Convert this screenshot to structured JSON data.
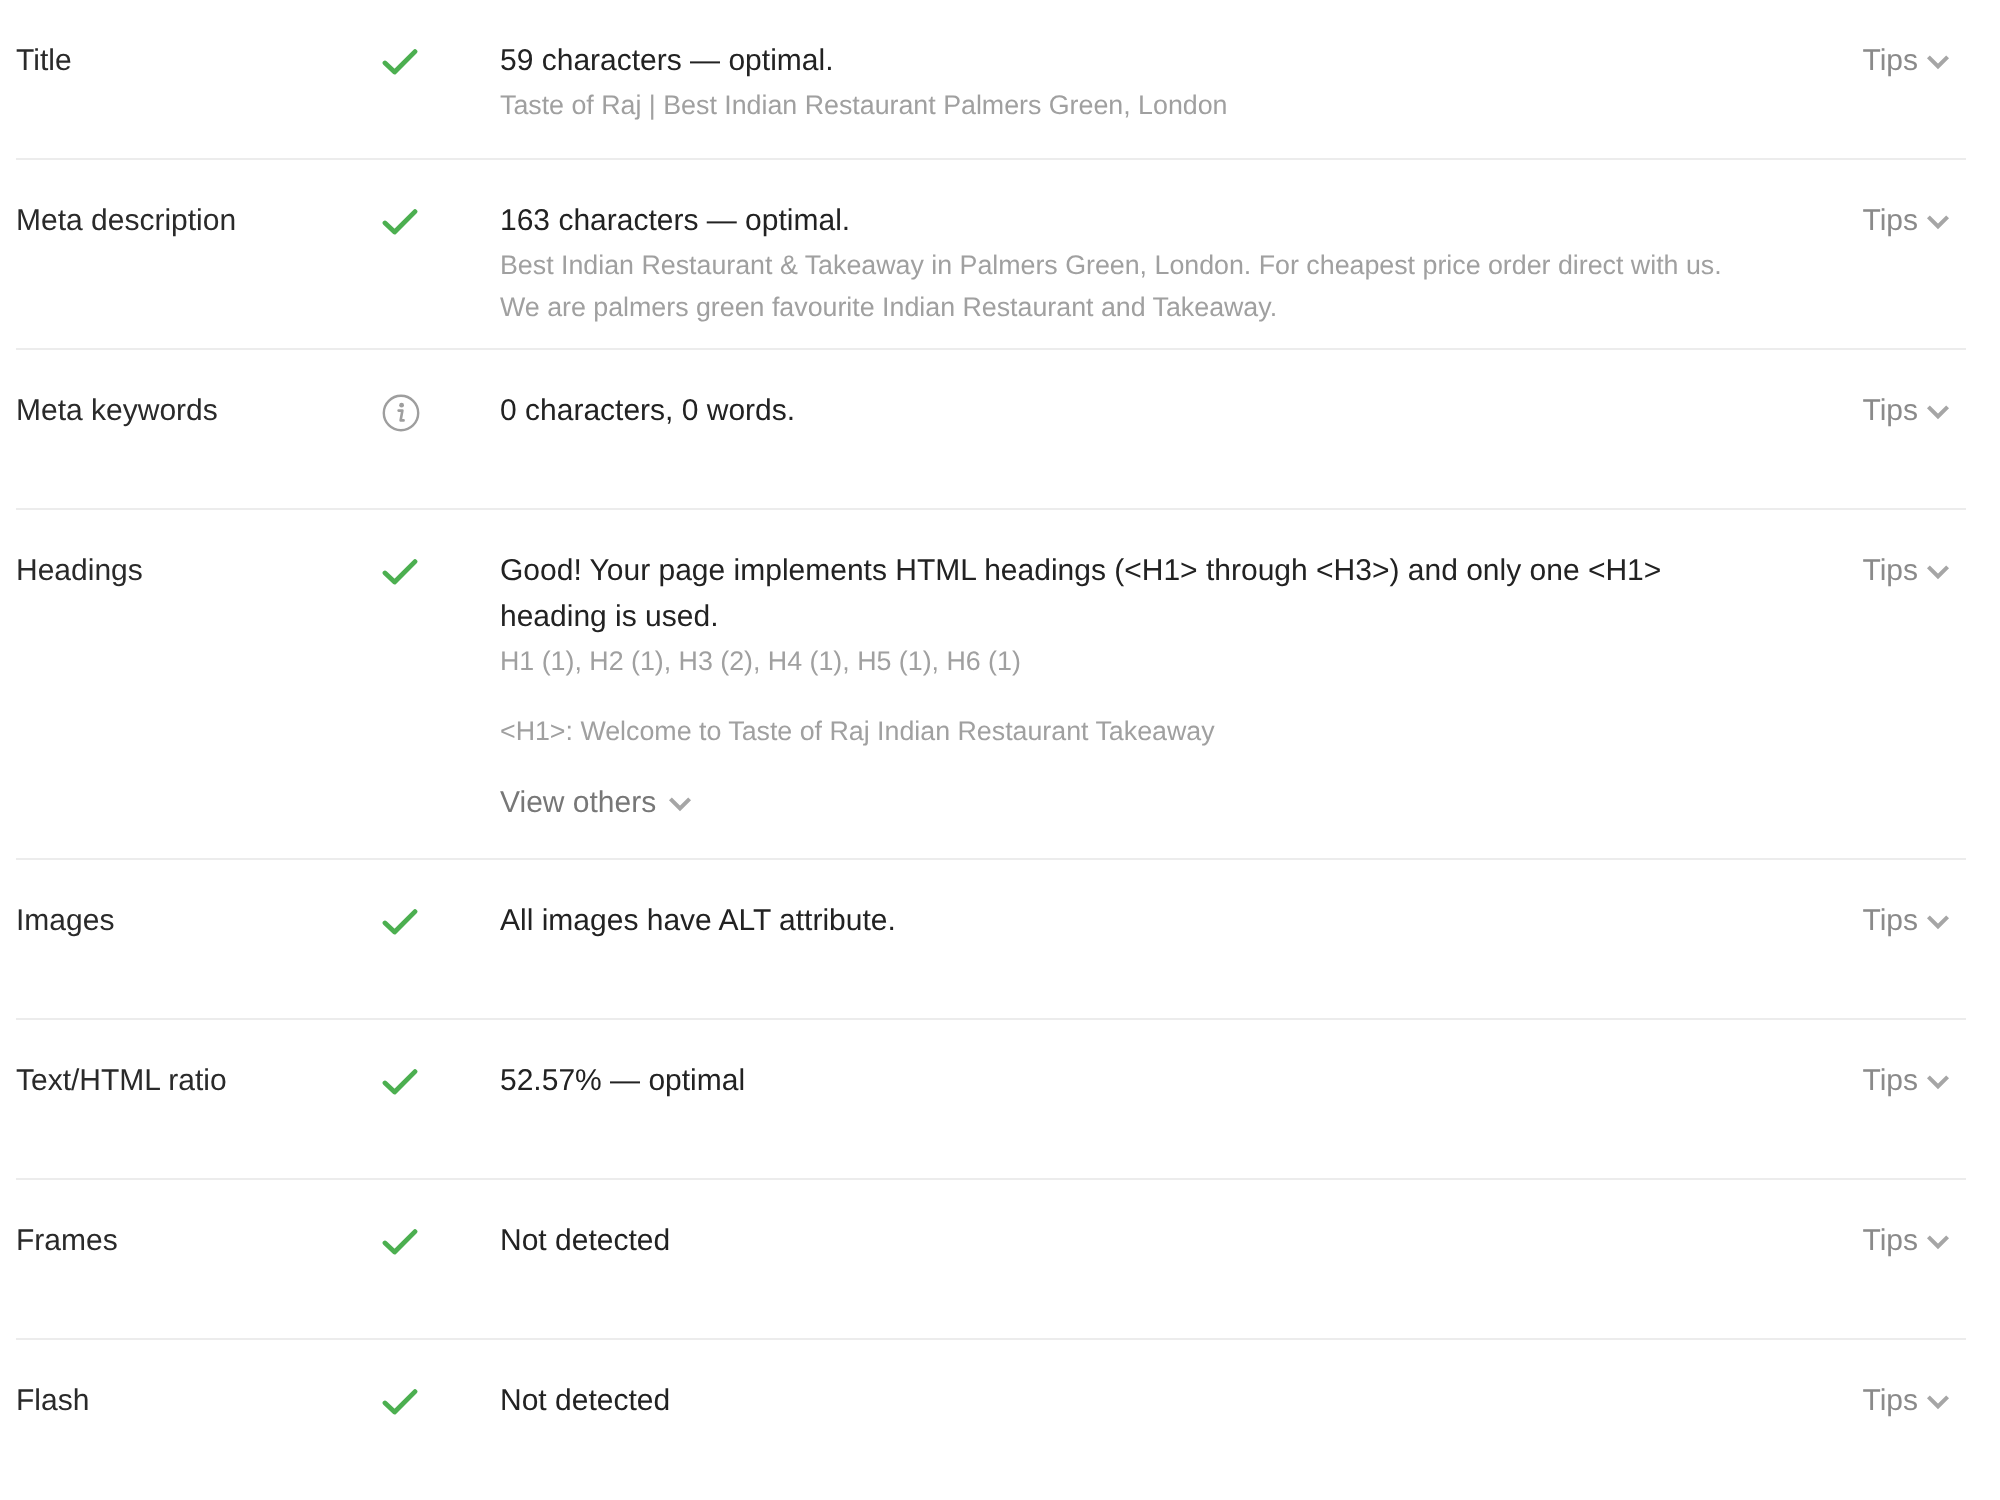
{
  "rows": [
    {
      "label": "Title",
      "kind": "pass",
      "summary": "59 characters — optimal.",
      "details": [
        "Taste of Raj | Best Indian Restaurant Palmers Green, London"
      ],
      "tips": {
        "label": "Tips",
        "expanded": false
      }
    },
    {
      "label": "Meta description",
      "kind": "pass",
      "summary": "163 characters — optimal.",
      "details": [
        "Best Indian Restaurant & Takeaway in Palmers Green, London. For cheapest price order direct with us. We are palmers green favourite Indian Restaurant and Takeaway."
      ],
      "tips": {
        "label": "Tips",
        "expanded": false
      }
    },
    {
      "label": "Meta keywords",
      "kind": "info",
      "summary": "0 characters, 0 words.",
      "tips": {
        "label": "Tips",
        "expanded": false
      }
    },
    {
      "label": "Headings",
      "kind": "pass",
      "summary": "Good! Your page implements HTML headings (<H1> through <H3>) and only one <H1> heading is used.",
      "details": [
        "H1 (1), H2 (1), H3 (2), H4 (1), H5 (1), H6 (1)"
      ],
      "sample": "<H1>: Welcome to Taste of Raj Indian Restaurant Takeaway",
      "more": {
        "label": "View others",
        "expanded": false
      },
      "tips": {
        "label": "Tips",
        "expanded": false
      }
    },
    {
      "label": "Images",
      "kind": "pass",
      "summary": "All images have ALT attribute.",
      "tips": {
        "label": "Tips",
        "expanded": false
      }
    },
    {
      "label": "Text/HTML ratio",
      "kind": "pass",
      "summary": "52.57% — optimal",
      "tips": {
        "label": "Tips",
        "expanded": false
      }
    },
    {
      "label": "Frames",
      "kind": "pass",
      "summary": "Not detected",
      "tips": {
        "label": "Tips",
        "expanded": false
      }
    },
    {
      "label": "Flash",
      "kind": "pass",
      "summary": "Not detected",
      "tips": {
        "label": "Tips",
        "expanded": false
      }
    }
  ]
}
